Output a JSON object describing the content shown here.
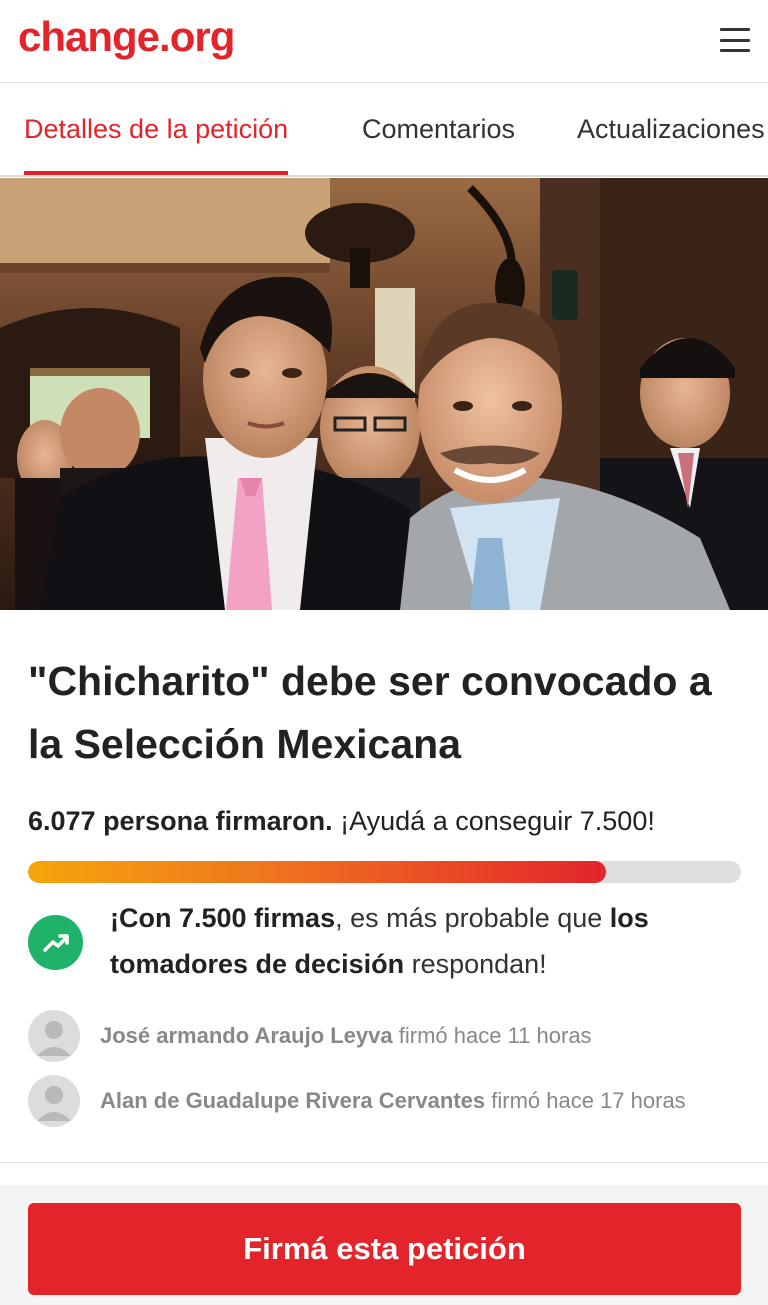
{
  "header": {
    "logo": "change.org",
    "menu_icon": "hamburger-menu-icon"
  },
  "tabs": [
    {
      "label": "Detalles de la petición",
      "active": true
    },
    {
      "label": "Comentarios",
      "active": false
    },
    {
      "label": "Actualizaciones",
      "active": false
    }
  ],
  "petition": {
    "title": "\"Chicharito\" debe ser convocado a la Selección Mexicana",
    "signed_count_text": "6.077 persona firmaron.",
    "goal_text": " ¡Ayudá a conseguir 7.500!",
    "progress": 0.81,
    "goal_message": {
      "part1": "¡Con 7.500 firmas",
      "part2": ", es más probable que ",
      "part3": "los tomadores de decisión",
      "part4": " respondan!"
    },
    "trend_icon": "trending-up-icon"
  },
  "signers": [
    {
      "name": "José armando Araujo Leyva",
      "action": " firmó hace 11 horas"
    },
    {
      "name": "Alan de Guadalupe Rivera Cervantes",
      "action": " firmó hace 17 horas"
    }
  ],
  "cta": {
    "label": "Firmá esta petición"
  },
  "colors": {
    "brand_red": "#e3242b",
    "progress_start": "#f5a60b",
    "trend_green": "#1fb36a"
  }
}
